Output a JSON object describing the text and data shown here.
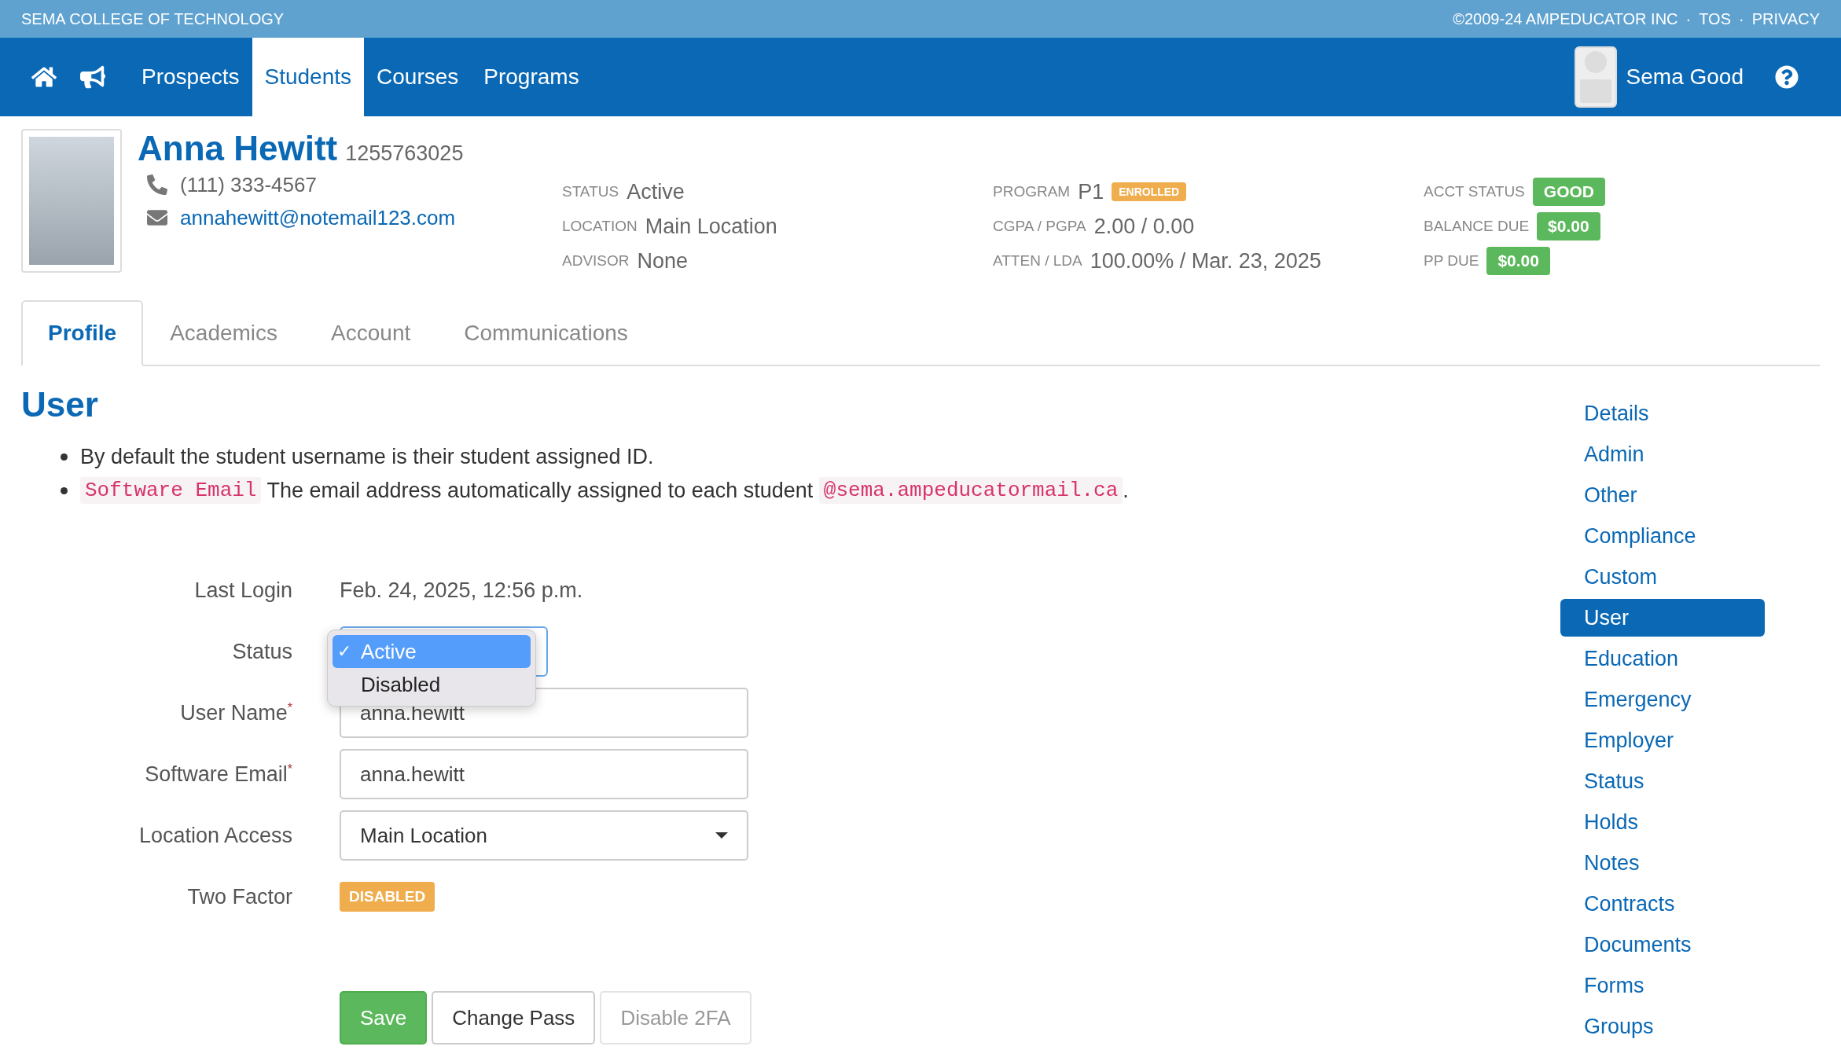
{
  "top_bar": {
    "school": "SEMA COLLEGE OF TECHNOLOGY",
    "copyright": "©2009-24 AMPEDUCATOR INC",
    "separator": "·",
    "links": [
      "TOS",
      "PRIVACY"
    ]
  },
  "nav": {
    "items": [
      {
        "label": "Prospects",
        "selected": false
      },
      {
        "label": "Students",
        "selected": true
      },
      {
        "label": "Courses",
        "selected": false
      },
      {
        "label": "Programs",
        "selected": false
      }
    ],
    "user": "Sema Good"
  },
  "student": {
    "name": "Anna Hewitt",
    "id": "1255763025",
    "phone": "(111) 333-4567",
    "email": "annahewitt@notemail123.com",
    "info_columns": [
      [
        {
          "label": "STATUS",
          "value": "Active"
        },
        {
          "label": "LOCATION",
          "value": "Main Location"
        },
        {
          "label": "ADVISOR",
          "value": "None"
        }
      ],
      [
        {
          "label": "PROGRAM",
          "value": "P1",
          "badge": "ENROLLED",
          "color": "#f0ad4e"
        },
        {
          "label": "CGPA / PGPA",
          "value": "2.00 / 0.00"
        },
        {
          "label": "ATTEN / LDA",
          "value": "100.00% / Mar. 23, 2025"
        }
      ],
      [
        {
          "label": "ACCT STATUS",
          "badge": "GOOD",
          "color": "#5cb85c"
        },
        {
          "label": "BALANCE DUE",
          "badge": "$0.00",
          "color": "#5cb85c"
        },
        {
          "label": "PP DUE",
          "badge": "$0.00",
          "color": "#5cb85c"
        }
      ]
    ]
  },
  "tabs": [
    {
      "label": "Profile",
      "selected": true
    },
    {
      "label": "Academics",
      "selected": false
    },
    {
      "label": "Account",
      "selected": false
    },
    {
      "label": "Communications",
      "selected": false
    }
  ],
  "section": {
    "title": "User",
    "notes": [
      [
        {
          "kind": "text",
          "text": "By default the student username is their student assigned ID."
        }
      ],
      [
        {
          "kind": "code",
          "text": "Software Email"
        },
        {
          "kind": "text",
          "text": " The email address automatically assigned to each student "
        },
        {
          "kind": "code",
          "text": "@sema.ampeducatormail.ca"
        },
        {
          "kind": "text",
          "text": "."
        }
      ]
    ]
  },
  "form": [
    {
      "kind": "text",
      "label": "Last Login",
      "value": "Feb. 24, 2025, 12:56 p.m."
    },
    {
      "kind": "open-select",
      "label": "Status",
      "options": [
        {
          "label": "Active",
          "selected": true,
          "mark": "✓"
        },
        {
          "label": "Disabled",
          "selected": false
        }
      ]
    },
    {
      "kind": "input",
      "label": "User Name",
      "required_mark": "*",
      "value": "anna.hewitt"
    },
    {
      "kind": "input",
      "label": "Software Email",
      "required_mark": "*",
      "value": "anna.hewitt"
    },
    {
      "kind": "select",
      "label": "Location Access",
      "value": "Main Location"
    },
    {
      "kind": "badge",
      "label": "Two Factor",
      "value": "DISABLED",
      "color": "#f0ad4e"
    }
  ],
  "buttons": [
    {
      "label": "Save",
      "kind": "primary",
      "disabled": false
    },
    {
      "label": "Change Pass",
      "kind": "default",
      "disabled": false
    },
    {
      "label": "Disable 2FA",
      "kind": "default",
      "disabled": true
    }
  ],
  "sidebar": {
    "items": [
      {
        "label": "Details",
        "selected": false
      },
      {
        "label": "Admin",
        "selected": false
      },
      {
        "label": "Other",
        "selected": false
      },
      {
        "label": "Compliance",
        "selected": false
      },
      {
        "label": "Custom",
        "selected": false
      },
      {
        "label": "User",
        "selected": true
      },
      {
        "label": "Education",
        "selected": false
      },
      {
        "label": "Emergency",
        "selected": false
      },
      {
        "label": "Employer",
        "selected": false
      },
      {
        "label": "Status",
        "selected": false
      },
      {
        "label": "Holds",
        "selected": false
      },
      {
        "label": "Notes",
        "selected": false
      },
      {
        "label": "Contracts",
        "selected": false
      },
      {
        "label": "Documents",
        "selected": false
      },
      {
        "label": "Forms",
        "selected": false
      },
      {
        "label": "Groups",
        "selected": false
      }
    ]
  }
}
